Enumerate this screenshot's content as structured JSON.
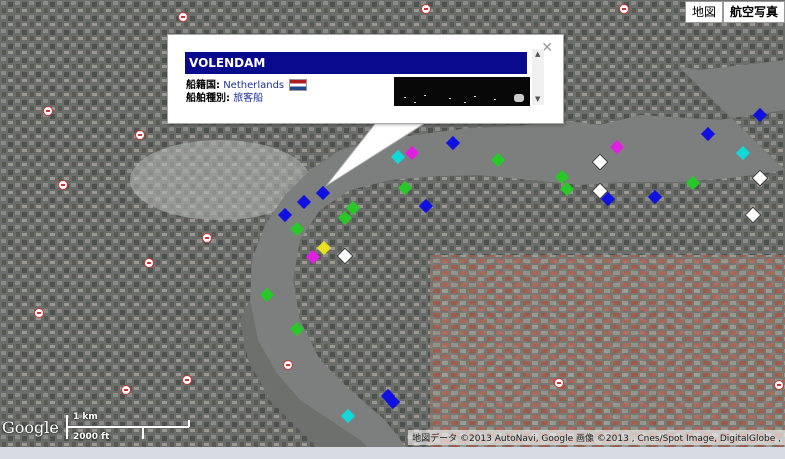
{
  "map_type": {
    "map_label": "地図",
    "satellite_label": "航空写真"
  },
  "popup": {
    "vessel_name": "VOLENDAM",
    "flag_label": "船籍国:",
    "flag_value": "Netherlands",
    "type_label": "船舶種別:",
    "type_value": "旅客船",
    "close_icon": "close-icon",
    "flag_icon": "netherlands-flag-icon"
  },
  "scale": {
    "km_label": "1 km",
    "ft_label": "2000 ft"
  },
  "branding": {
    "logo": "Google"
  },
  "attribution": "地図データ ©2013 AutoNavi, Google 画像 ©2013 , Cnes/Spot Image, DigitalGlobe ,",
  "colors": {
    "popup_title_bg": "#0a0a8e",
    "river": "#7c7f7d",
    "ship_blue": "#1010e0",
    "ship_green": "#28c828",
    "ship_cyan": "#10d8d8",
    "ship_magenta": "#e020e0"
  }
}
